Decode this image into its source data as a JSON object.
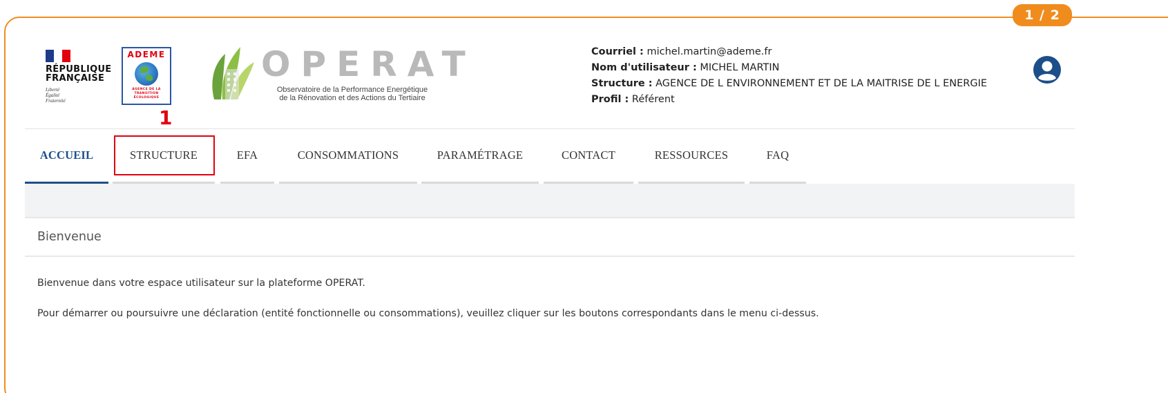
{
  "page_badge": "1 / 2",
  "header": {
    "rf_logo": {
      "title_line1": "RÉPUBLIQUE",
      "title_line2": "FRANÇAISE",
      "motto_line1": "Liberté",
      "motto_line2": "Égalité",
      "motto_line3": "Fraternité"
    },
    "ademe_logo": {
      "name": "ADEME",
      "sub_line1": "AGENCE DE LA",
      "sub_line2": "TRANSITION",
      "sub_line3": "ÉCOLOGIQUE"
    },
    "operat_logo": {
      "wordmark": "OPERAT",
      "tagline_line1": "Observatoire de la Performance Energétique",
      "tagline_line2": "de la Rénovation et des Actions du Tertiaire"
    },
    "user": {
      "email_label": "Courriel :",
      "email_value": "michel.martin@ademe.fr",
      "username_label": "Nom d'utilisateur :",
      "username_value": "MICHEL MARTIN",
      "structure_label": "Structure :",
      "structure_value": "AGENCE DE L ENVIRONNEMENT ET DE LA MAITRISE DE L ENERGIE",
      "profile_label": "Profil :",
      "profile_value": "Référent"
    }
  },
  "step_marker": "1",
  "nav": {
    "items": [
      {
        "label": "ACCUEIL",
        "active": true
      },
      {
        "label": "STRUCTURE",
        "active": false
      },
      {
        "label": "EFA",
        "active": false
      },
      {
        "label": "CONSOMMATIONS",
        "active": false
      },
      {
        "label": "PARAMÉTRAGE",
        "active": false
      },
      {
        "label": "CONTACT",
        "active": false
      },
      {
        "label": "RESSOURCES",
        "active": false
      },
      {
        "label": "FAQ",
        "active": false
      }
    ]
  },
  "main": {
    "title": "Bienvenue",
    "paragraph1": "Bienvenue dans votre espace utilisateur sur la plateforme OPERAT.",
    "paragraph2": "Pour démarrer ou poursuivre une déclaration (entité fonctionnelle ou consommations), veuillez cliquer sur les boutons correspondants dans le menu ci-dessus."
  },
  "colors": {
    "accent_orange": "#f08c1e",
    "nav_active": "#1c4f8a",
    "highlight_red": "#e1000f"
  }
}
